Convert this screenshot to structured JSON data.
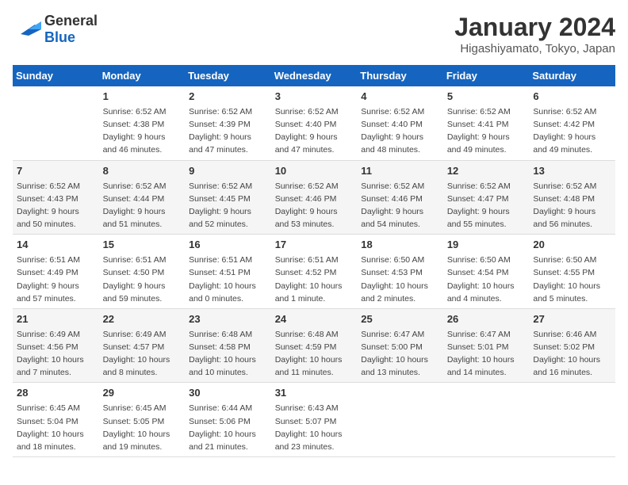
{
  "header": {
    "logo_general": "General",
    "logo_blue": "Blue",
    "month_title": "January 2024",
    "location": "Higashiyamato, Tokyo, Japan"
  },
  "days_of_week": [
    "Sunday",
    "Monday",
    "Tuesday",
    "Wednesday",
    "Thursday",
    "Friday",
    "Saturday"
  ],
  "weeks": [
    [
      {
        "num": "",
        "sunrise": "",
        "sunset": "",
        "daylight": ""
      },
      {
        "num": "1",
        "sunrise": "Sunrise: 6:52 AM",
        "sunset": "Sunset: 4:38 PM",
        "daylight": "Daylight: 9 hours and 46 minutes."
      },
      {
        "num": "2",
        "sunrise": "Sunrise: 6:52 AM",
        "sunset": "Sunset: 4:39 PM",
        "daylight": "Daylight: 9 hours and 47 minutes."
      },
      {
        "num": "3",
        "sunrise": "Sunrise: 6:52 AM",
        "sunset": "Sunset: 4:40 PM",
        "daylight": "Daylight: 9 hours and 47 minutes."
      },
      {
        "num": "4",
        "sunrise": "Sunrise: 6:52 AM",
        "sunset": "Sunset: 4:40 PM",
        "daylight": "Daylight: 9 hours and 48 minutes."
      },
      {
        "num": "5",
        "sunrise": "Sunrise: 6:52 AM",
        "sunset": "Sunset: 4:41 PM",
        "daylight": "Daylight: 9 hours and 49 minutes."
      },
      {
        "num": "6",
        "sunrise": "Sunrise: 6:52 AM",
        "sunset": "Sunset: 4:42 PM",
        "daylight": "Daylight: 9 hours and 49 minutes."
      }
    ],
    [
      {
        "num": "7",
        "sunrise": "Sunrise: 6:52 AM",
        "sunset": "Sunset: 4:43 PM",
        "daylight": "Daylight: 9 hours and 50 minutes."
      },
      {
        "num": "8",
        "sunrise": "Sunrise: 6:52 AM",
        "sunset": "Sunset: 4:44 PM",
        "daylight": "Daylight: 9 hours and 51 minutes."
      },
      {
        "num": "9",
        "sunrise": "Sunrise: 6:52 AM",
        "sunset": "Sunset: 4:45 PM",
        "daylight": "Daylight: 9 hours and 52 minutes."
      },
      {
        "num": "10",
        "sunrise": "Sunrise: 6:52 AM",
        "sunset": "Sunset: 4:46 PM",
        "daylight": "Daylight: 9 hours and 53 minutes."
      },
      {
        "num": "11",
        "sunrise": "Sunrise: 6:52 AM",
        "sunset": "Sunset: 4:46 PM",
        "daylight": "Daylight: 9 hours and 54 minutes."
      },
      {
        "num": "12",
        "sunrise": "Sunrise: 6:52 AM",
        "sunset": "Sunset: 4:47 PM",
        "daylight": "Daylight: 9 hours and 55 minutes."
      },
      {
        "num": "13",
        "sunrise": "Sunrise: 6:52 AM",
        "sunset": "Sunset: 4:48 PM",
        "daylight": "Daylight: 9 hours and 56 minutes."
      }
    ],
    [
      {
        "num": "14",
        "sunrise": "Sunrise: 6:51 AM",
        "sunset": "Sunset: 4:49 PM",
        "daylight": "Daylight: 9 hours and 57 minutes."
      },
      {
        "num": "15",
        "sunrise": "Sunrise: 6:51 AM",
        "sunset": "Sunset: 4:50 PM",
        "daylight": "Daylight: 9 hours and 59 minutes."
      },
      {
        "num": "16",
        "sunrise": "Sunrise: 6:51 AM",
        "sunset": "Sunset: 4:51 PM",
        "daylight": "Daylight: 10 hours and 0 minutes."
      },
      {
        "num": "17",
        "sunrise": "Sunrise: 6:51 AM",
        "sunset": "Sunset: 4:52 PM",
        "daylight": "Daylight: 10 hours and 1 minute."
      },
      {
        "num": "18",
        "sunrise": "Sunrise: 6:50 AM",
        "sunset": "Sunset: 4:53 PM",
        "daylight": "Daylight: 10 hours and 2 minutes."
      },
      {
        "num": "19",
        "sunrise": "Sunrise: 6:50 AM",
        "sunset": "Sunset: 4:54 PM",
        "daylight": "Daylight: 10 hours and 4 minutes."
      },
      {
        "num": "20",
        "sunrise": "Sunrise: 6:50 AM",
        "sunset": "Sunset: 4:55 PM",
        "daylight": "Daylight: 10 hours and 5 minutes."
      }
    ],
    [
      {
        "num": "21",
        "sunrise": "Sunrise: 6:49 AM",
        "sunset": "Sunset: 4:56 PM",
        "daylight": "Daylight: 10 hours and 7 minutes."
      },
      {
        "num": "22",
        "sunrise": "Sunrise: 6:49 AM",
        "sunset": "Sunset: 4:57 PM",
        "daylight": "Daylight: 10 hours and 8 minutes."
      },
      {
        "num": "23",
        "sunrise": "Sunrise: 6:48 AM",
        "sunset": "Sunset: 4:58 PM",
        "daylight": "Daylight: 10 hours and 10 minutes."
      },
      {
        "num": "24",
        "sunrise": "Sunrise: 6:48 AM",
        "sunset": "Sunset: 4:59 PM",
        "daylight": "Daylight: 10 hours and 11 minutes."
      },
      {
        "num": "25",
        "sunrise": "Sunrise: 6:47 AM",
        "sunset": "Sunset: 5:00 PM",
        "daylight": "Daylight: 10 hours and 13 minutes."
      },
      {
        "num": "26",
        "sunrise": "Sunrise: 6:47 AM",
        "sunset": "Sunset: 5:01 PM",
        "daylight": "Daylight: 10 hours and 14 minutes."
      },
      {
        "num": "27",
        "sunrise": "Sunrise: 6:46 AM",
        "sunset": "Sunset: 5:02 PM",
        "daylight": "Daylight: 10 hours and 16 minutes."
      }
    ],
    [
      {
        "num": "28",
        "sunrise": "Sunrise: 6:45 AM",
        "sunset": "Sunset: 5:04 PM",
        "daylight": "Daylight: 10 hours and 18 minutes."
      },
      {
        "num": "29",
        "sunrise": "Sunrise: 6:45 AM",
        "sunset": "Sunset: 5:05 PM",
        "daylight": "Daylight: 10 hours and 19 minutes."
      },
      {
        "num": "30",
        "sunrise": "Sunrise: 6:44 AM",
        "sunset": "Sunset: 5:06 PM",
        "daylight": "Daylight: 10 hours and 21 minutes."
      },
      {
        "num": "31",
        "sunrise": "Sunrise: 6:43 AM",
        "sunset": "Sunset: 5:07 PM",
        "daylight": "Daylight: 10 hours and 23 minutes."
      },
      {
        "num": "",
        "sunrise": "",
        "sunset": "",
        "daylight": ""
      },
      {
        "num": "",
        "sunrise": "",
        "sunset": "",
        "daylight": ""
      },
      {
        "num": "",
        "sunrise": "",
        "sunset": "",
        "daylight": ""
      }
    ]
  ]
}
